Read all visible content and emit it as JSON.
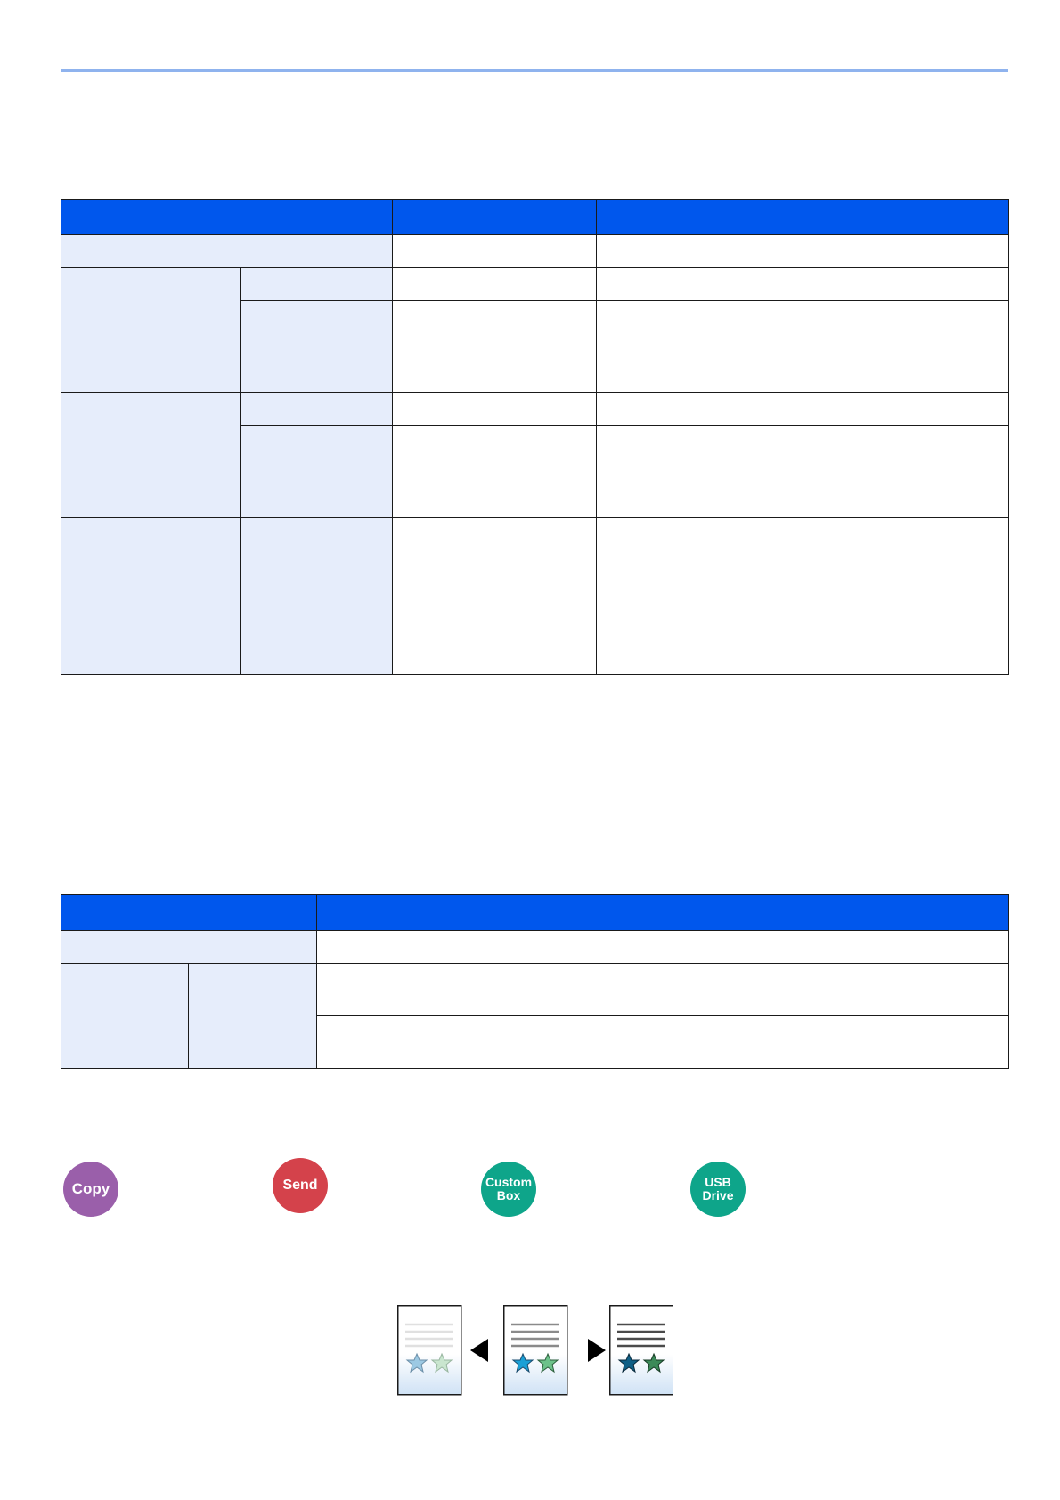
{
  "badges": {
    "copy": "Copy",
    "send": "Send",
    "custom_box_line1": "Custom",
    "custom_box_line2": "Box",
    "usb_line1": "USB",
    "usb_line2": "Drive"
  },
  "colors": {
    "header_blue": "#0057ed",
    "key_cell": "#e6edfb",
    "rule": "#8fb3ee",
    "copy": "#9a5faa",
    "send": "#d4424b",
    "box_usb": "#0ea58a"
  },
  "icons": [
    "page-light-icon",
    "arrow-left-icon",
    "page-normal-icon",
    "arrow-right-icon",
    "page-dark-icon"
  ]
}
